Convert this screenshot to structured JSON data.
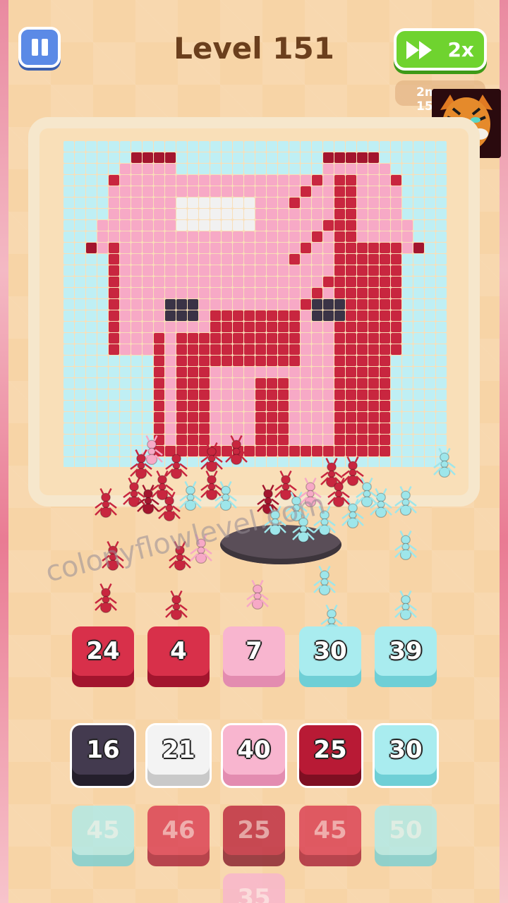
{
  "header": {
    "level_title": "Level 151",
    "speed_label": "2x",
    "timer_text": "2m 15s"
  },
  "colors": {
    "red": "#c8263f",
    "dark_red": "#a3152e",
    "pink": "#f7a9c6",
    "light_blue": "#9ee6ea",
    "white": "#f1f1f1",
    "dark": "#3a3346",
    "grid_empty": "#bfeff4"
  },
  "icons": [
    "pause-icon",
    "fast-forward-icon",
    "tiger-avatar-icon"
  ],
  "watermark": "colonyflowlevel.com",
  "active_tiles": [
    {
      "value": "24",
      "color": "red"
    },
    {
      "value": "4",
      "color": "red"
    },
    {
      "value": "7",
      "color": "pink"
    },
    {
      "value": "30",
      "color": "light_blue"
    },
    {
      "value": "39",
      "color": "light_blue"
    }
  ],
  "queue_row_1": [
    {
      "value": "16",
      "color": "dark"
    },
    {
      "value": "21",
      "color": "white"
    },
    {
      "value": "40",
      "color": "pink"
    },
    {
      "value": "25",
      "color": "dark_red"
    },
    {
      "value": "30",
      "color": "light_blue"
    }
  ],
  "queue_row_2": [
    {
      "value": "45",
      "color": "light_blue"
    },
    {
      "value": "46",
      "color": "red"
    },
    {
      "value": "25",
      "color": "dark_red"
    },
    {
      "value": "45",
      "color": "red"
    },
    {
      "value": "50",
      "color": "light_blue"
    }
  ],
  "queue_row_3": [
    {
      "value": "35",
      "color": "pink"
    }
  ]
}
